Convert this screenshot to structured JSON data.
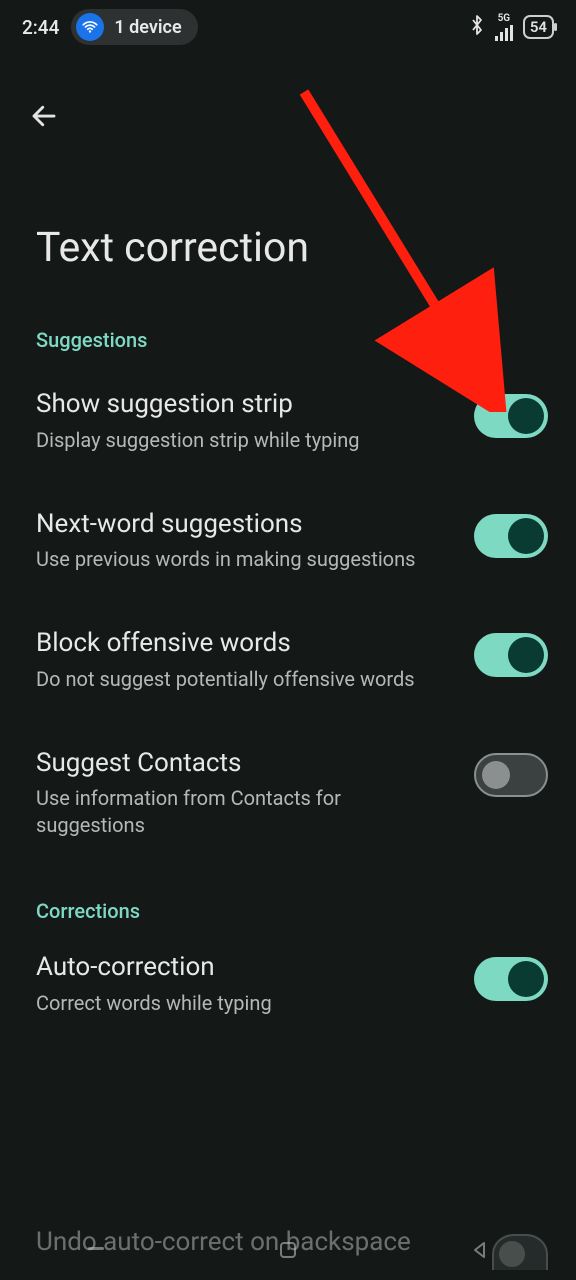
{
  "status": {
    "time": "2:44",
    "device_pill": "1 device",
    "network_label": "5G",
    "battery": "54"
  },
  "header": {
    "title": "Text correction"
  },
  "sections": [
    {
      "heading": "Suggestions",
      "items": [
        {
          "title": "Show suggestion strip",
          "sub": "Display suggestion strip while typing",
          "on": true
        },
        {
          "title": "Next-word suggestions",
          "sub": "Use previous words in making suggestions",
          "on": true
        },
        {
          "title": "Block offensive words",
          "sub": "Do not suggest potentially offensive words",
          "on": true
        },
        {
          "title": "Suggest Contacts",
          "sub": "Use information from Contacts for suggestions",
          "on": false
        }
      ]
    },
    {
      "heading": "Corrections",
      "items": [
        {
          "title": "Auto-correction",
          "sub": "Correct words while typing",
          "on": true
        },
        {
          "title": "Undo auto-correct on backspace",
          "sub": "",
          "on": false
        }
      ]
    }
  ],
  "annotation": {
    "type": "arrow",
    "color": "#ff1f0f",
    "target": "show-suggestion-strip-toggle"
  }
}
